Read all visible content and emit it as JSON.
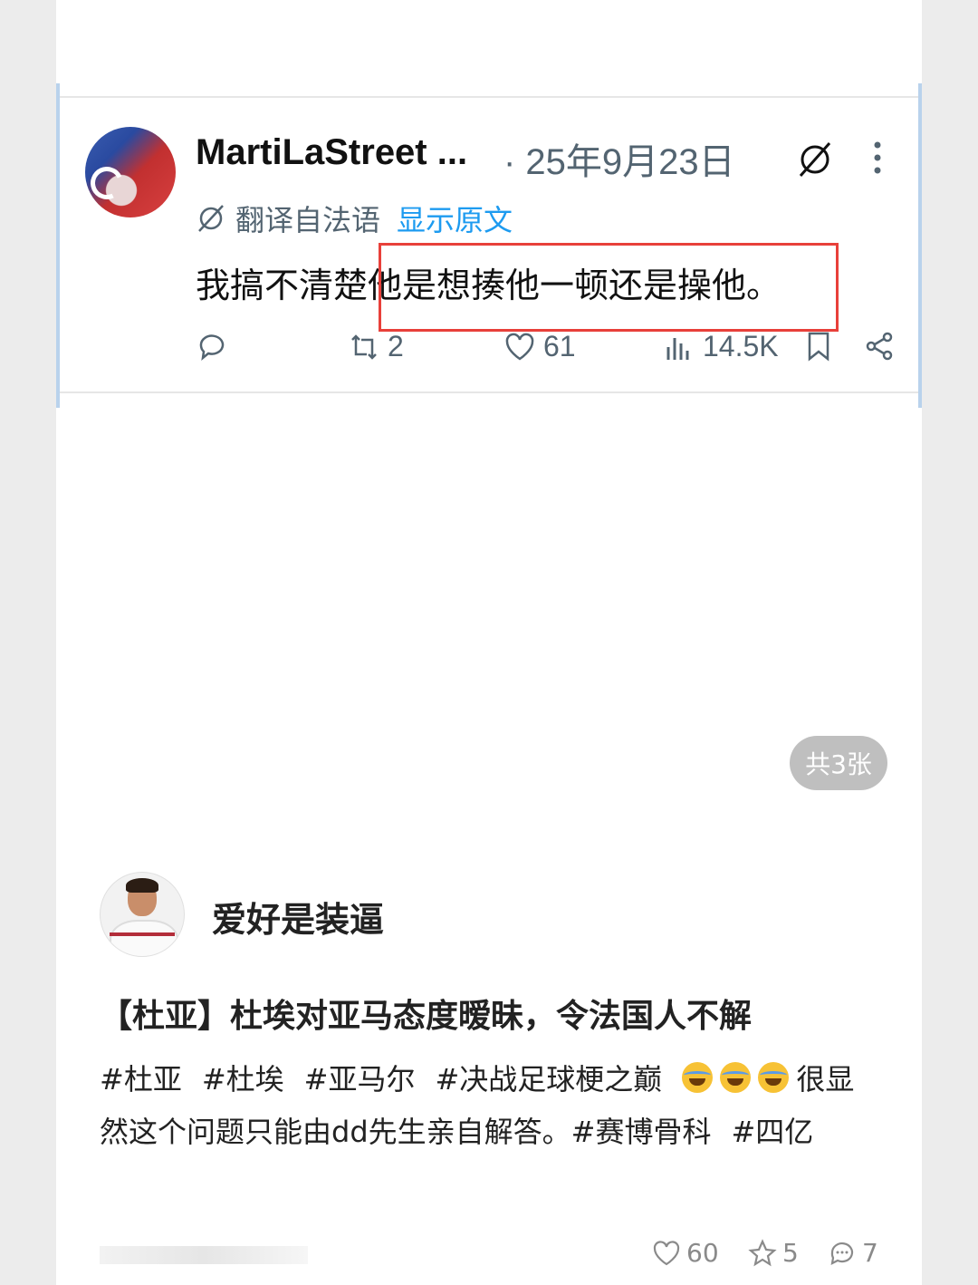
{
  "tweet": {
    "name": "MartiLaStreet ...",
    "date": "· 25年9月23日",
    "translate_label": "翻译自法语",
    "show_original": "显示原文",
    "text_before": "我搞不清楚",
    "text_highlight": "他是想揍他一顿还是操他。",
    "reply_count": "",
    "retweet_count": "2",
    "like_count": "61",
    "view_count": "14.5K"
  },
  "gallery": {
    "count_label": "共3张"
  },
  "post": {
    "author_name": "爱好是装逼",
    "title": "【杜亚】杜埃对亚马态度暧昧，令法国人不解",
    "tags_line1": [
      "#杜亚",
      "#杜埃",
      "#亚马尔",
      "#决战足球梗之巅"
    ],
    "body_after_emoji": "很显然这个问题只能由dd先生亲自解答。",
    "tags_end": [
      "#赛博骨科",
      "#四亿"
    ]
  },
  "stats": {
    "likes": "60",
    "favorites": "5",
    "comments": "7"
  }
}
